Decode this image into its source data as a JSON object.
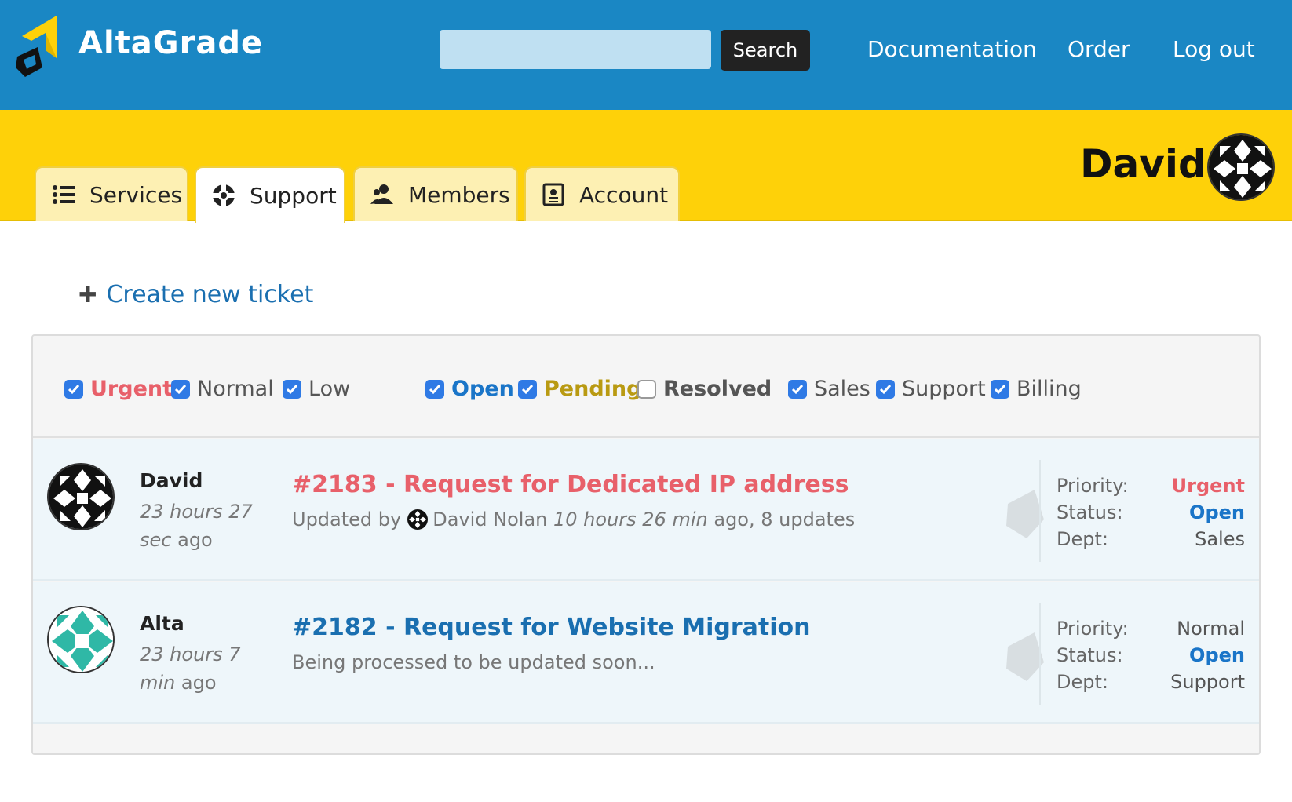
{
  "header": {
    "brand": "AltaGrade",
    "search_placeholder": "",
    "search_button": "Search",
    "nav": [
      "Documentation",
      "Order",
      "Log out"
    ]
  },
  "tabs": [
    {
      "label": "Services",
      "icon": "list-icon"
    },
    {
      "label": "Support",
      "icon": "lifebuoy-icon",
      "active": true
    },
    {
      "label": "Members",
      "icon": "members-icon"
    },
    {
      "label": "Account",
      "icon": "contact-card-icon"
    }
  ],
  "user": {
    "name": "David"
  },
  "create_ticket": "Create new ticket",
  "filters": {
    "priority": [
      {
        "label": "Urgent",
        "checked": true
      },
      {
        "label": "Normal",
        "checked": true
      },
      {
        "label": "Low",
        "checked": true
      }
    ],
    "status": [
      {
        "label": "Open",
        "checked": true
      },
      {
        "label": "Pending",
        "checked": true
      },
      {
        "label": "Resolved",
        "checked": false
      }
    ],
    "department": [
      {
        "label": "Sales",
        "checked": true
      },
      {
        "label": "Support",
        "checked": true
      },
      {
        "label": "Billing",
        "checked": true
      }
    ]
  },
  "tickets": [
    {
      "author": "David",
      "time_italic": "23 hours 27 sec",
      "time_suffix": "ago",
      "title": "#2183 - Request for Dedicated IP address",
      "sub_prefix": "Updated by",
      "sub_user": "David Nolan",
      "sub_time": "10 hours 26 min",
      "sub_suffix": "ago, 8 updates",
      "priority_label": "Priority:",
      "priority": "Urgent",
      "status_label": "Status:",
      "status": "Open",
      "dept_label": "Dept:",
      "dept": "Sales"
    },
    {
      "author": "Alta",
      "time_italic": "23 hours 7 min",
      "time_suffix": "ago",
      "title": "#2182 - Request for Website Migration",
      "sub_text": "Being processed to be updated soon...",
      "priority_label": "Priority:",
      "priority": "Normal",
      "status_label": "Status:",
      "status": "Open",
      "dept_label": "Dept:",
      "dept": "Support"
    }
  ],
  "colors": {
    "header_blue": "#1a87c4",
    "tab_yellow": "#fed109",
    "urgent": "#e8606a",
    "open": "#1a75c8",
    "pending": "#b99a12",
    "link": "#1a6fb0"
  }
}
